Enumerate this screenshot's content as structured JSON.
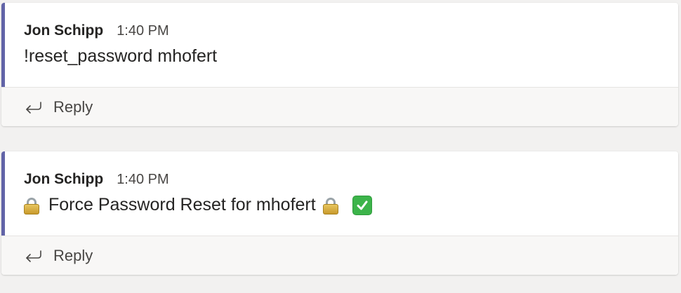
{
  "messages": [
    {
      "author": "Jon Schipp",
      "time": "1:40 PM",
      "text": "!reset_password mhofert",
      "reply_label": "Reply"
    },
    {
      "author": "Jon Schipp",
      "time": "1:40 PM",
      "text": "Force Password Reset for mhofert",
      "leading_icon": "lock-icon",
      "trailing_icons": [
        "lock-icon",
        "check-mark-icon"
      ],
      "reply_label": "Reply"
    }
  ],
  "colors": {
    "accent_bar": "#6264a7",
    "background": "#f2f1f0",
    "card": "#ffffff",
    "reply_row": "#f8f7f6",
    "check": "#3cb44a"
  }
}
